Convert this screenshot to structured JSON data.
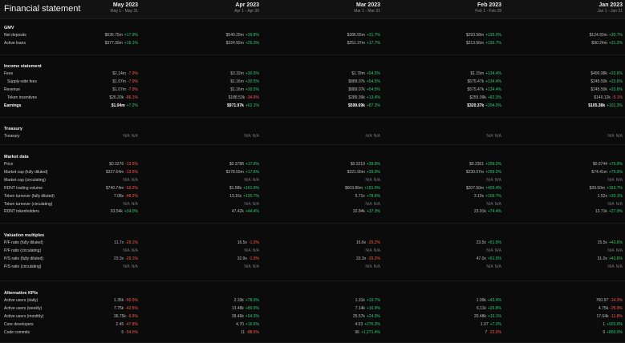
{
  "page_title": "Financial statement",
  "columns": [
    {
      "month": "May 2023",
      "range": "May 1 - May 31"
    },
    {
      "month": "Apr 2023",
      "range": "Apr 1 - Apr 30"
    },
    {
      "month": "Mar 2023",
      "range": "Mar 1 - Mar 31"
    },
    {
      "month": "Feb 2023",
      "range": "Feb 1 - Feb 28"
    },
    {
      "month": "Jan 2023",
      "range": "Jan 1 - Jan 31"
    }
  ],
  "sections": [
    {
      "title": "GMV",
      "rows": [
        {
          "label": "Net deposits",
          "cells": [
            [
              "$636.75m",
              "+17.9%"
            ],
            [
              "$540.29m",
              "+39.8%"
            ],
            [
              "$386.55m",
              "+31.7%"
            ],
            [
              "$293.58m",
              "+135.0%"
            ],
            [
              "$124.93m",
              "+30.7%"
            ]
          ]
        },
        {
          "label": "Active loans",
          "cells": [
            [
              "$377.39m",
              "+16.1%"
            ],
            [
              "$324.92m",
              "+29.3%"
            ],
            [
              "$251.37m",
              "+17.7%"
            ],
            [
              "$213.56m",
              "+136.7%"
            ],
            [
              "$90.24m",
              "+31.2%"
            ]
          ]
        }
      ]
    },
    {
      "title": "Income statement",
      "rows": [
        {
          "label": "Fees",
          "cells": [
            [
              "$2.14m",
              "-7.9%"
            ],
            [
              "$3.32m",
              "+30.5%"
            ],
            [
              "$1.78m",
              "+54.5%"
            ],
            [
              "$1.15m",
              "+134.4%"
            ],
            [
              "$490.98k",
              "+33.6%"
            ]
          ]
        },
        {
          "label": "Supply-side fees",
          "indent": true,
          "cells": [
            [
              "$1.07m",
              "-7.9%"
            ],
            [
              "$1.16m",
              "+30.5%"
            ],
            [
              "$889.07k",
              "+54.5%"
            ],
            [
              "$575.47k",
              "+134.4%"
            ],
            [
              "$245.50k",
              "+33.6%"
            ]
          ]
        },
        {
          "label": "Revenue",
          "cells": [
            [
              "$1.07m",
              "-7.9%"
            ],
            [
              "$1.16m",
              "+30.5%"
            ],
            [
              "$889.07k",
              "+54.5%"
            ],
            [
              "$575.47k",
              "+134.4%"
            ],
            [
              "$245.50k",
              "+33.6%"
            ]
          ]
        },
        {
          "label": "Token incentives",
          "indent": true,
          "cells": [
            [
              "$26.20k",
              "-86.1%"
            ],
            [
              "$188.53k",
              "-34.9%"
            ],
            [
              "$289.39k",
              "+13.4%"
            ],
            [
              "$255.09k",
              "+82.3%"
            ],
            [
              "$140.12k",
              "-5.1%"
            ]
          ]
        },
        {
          "label": "Earnings",
          "bold": true,
          "cells": [
            [
              "$1.04m",
              "+7.2%"
            ],
            [
              "$971.97k",
              "+62.1%"
            ],
            [
              "$599.69k",
              "+87.3%"
            ],
            [
              "$320.37k",
              "+204.0%"
            ],
            [
              "$105.38k",
              "+101.3%"
            ]
          ]
        }
      ]
    },
    {
      "title": "Treasury",
      "rows": [
        {
          "label": "Treasury",
          "cells": [
            [
              "N/A",
              "N/A"
            ],
            [
              "N/A",
              "N/A"
            ],
            [
              "N/A",
              "N/A"
            ],
            [
              "N/A",
              "N/A"
            ],
            [
              "N/A",
              "N/A"
            ]
          ]
        }
      ]
    },
    {
      "title": "Market data",
      "rows": [
        {
          "label": "Price",
          "cells": [
            [
              "$0.3276",
              "-13.5%"
            ],
            [
              "$0.3788",
              "+17.6%"
            ],
            [
              "$0.3219",
              "+39.9%"
            ],
            [
              "$0.2301",
              "+209.2%"
            ],
            [
              "$0.0744",
              "+75.9%"
            ]
          ]
        },
        {
          "label": "Market cap (fully diluted)",
          "cells": [
            [
              "$327.64m",
              "-13.5%"
            ],
            [
              "$378.59m",
              "+17.6%"
            ],
            [
              "$321.90m",
              "+39.9%"
            ],
            [
              "$230.07m",
              "+209.2%"
            ],
            [
              "$74.41m",
              "+75.9%"
            ]
          ]
        },
        {
          "label": "Market cap (circulating)",
          "cells": [
            [
              "N/A",
              "N/A"
            ],
            [
              "N/A",
              "N/A"
            ],
            [
              "N/A",
              "N/A"
            ],
            [
              "N/A",
              "N/A"
            ],
            [
              "N/A",
              "N/A"
            ]
          ]
        },
        {
          "label": "RDNT trading volume",
          "cells": [
            [
              "$740.74m",
              "-53.2%"
            ],
            [
              "$1.58b",
              "+161.9%"
            ],
            [
              "$603.86m",
              "+191.0%"
            ],
            [
              "$207.50m",
              "+425.4%"
            ],
            [
              "$39.50m",
              "+153.7%"
            ]
          ]
        },
        {
          "label": "Token turnover (fully diluted)",
          "cells": [
            [
              "7.08x",
              "-46.2%"
            ],
            [
              "13.16x",
              "+130.7%"
            ],
            [
              "5.71x",
              "+78.6%"
            ],
            [
              "3.19x",
              "+109.7%"
            ],
            [
              "1.52x",
              "+30.1%"
            ]
          ]
        },
        {
          "label": "Token turnover (circulating)",
          "cells": [
            [
              "N/A",
              "N/A"
            ],
            [
              "N/A",
              "N/A"
            ],
            [
              "N/A",
              "N/A"
            ],
            [
              "N/A",
              "N/A"
            ],
            [
              "N/A",
              "N/A"
            ]
          ]
        },
        {
          "label": "RDNT tokenholders",
          "cells": [
            [
              "63.54k",
              "+34.0%"
            ],
            [
              "47.42k",
              "+44.4%"
            ],
            [
              "32.84k",
              "+37.3%"
            ],
            [
              "23.91k",
              "+74.4%"
            ],
            [
              "13.71k",
              "+27.9%"
            ]
          ]
        }
      ]
    },
    {
      "title": "Valuation multiples",
      "rows": [
        {
          "label": "P/F ratio (fully diluted)",
          "cells": [
            [
              "11.7x",
              "-29.1%"
            ],
            [
              "16.5x",
              "-1.0%"
            ],
            [
              "16.6x",
              "-29.2%"
            ],
            [
              "23.5x",
              "+51.5%"
            ],
            [
              "15.5x",
              "+43.6%"
            ]
          ]
        },
        {
          "label": "P/F ratio (circulating)",
          "cells": [
            [
              "N/A",
              "N/A"
            ],
            [
              "N/A",
              "N/A"
            ],
            [
              "N/A",
              "N/A"
            ],
            [
              "N/A",
              "N/A"
            ],
            [
              "N/A",
              "N/A"
            ]
          ]
        },
        {
          "label": "P/S ratio (fully diluted)",
          "cells": [
            [
              "23.3x",
              "-29.1%"
            ],
            [
              "32.9x",
              "-1.0%"
            ],
            [
              "33.3x",
              "-29.2%"
            ],
            [
              "47.0x",
              "+51.5%"
            ],
            [
              "31.0x",
              "+43.6%"
            ]
          ]
        },
        {
          "label": "P/S ratio (circulating)",
          "cells": [
            [
              "N/A",
              "N/A"
            ],
            [
              "N/A",
              "N/A"
            ],
            [
              "N/A",
              "N/A"
            ],
            [
              "N/A",
              "N/A"
            ],
            [
              "N/A",
              "N/A"
            ]
          ]
        }
      ]
    },
    {
      "title": "Alternative KPIs",
      "rows": [
        {
          "label": "Active users (daily)",
          "cells": [
            [
              "1.35k",
              "-50.5%"
            ],
            [
              "2.33k",
              "+78.0%"
            ],
            [
              "1.31k",
              "+19.7%"
            ],
            [
              "1.09k",
              "+43.4%"
            ],
            [
              "760.97",
              "-14.3%"
            ]
          ]
        },
        {
          "label": "Active users (weekly)",
          "cells": [
            [
              "7.75k",
              "-42.5%"
            ],
            [
              "13.48k",
              "+89.9%"
            ],
            [
              "7.14k",
              "+16.9%"
            ],
            [
              "6.11k",
              "+26.8%"
            ],
            [
              "4.75k",
              "-25.0%"
            ]
          ]
        },
        {
          "label": "Active users (monthly)",
          "cells": [
            [
              "36.75k",
              "-6.9%"
            ],
            [
              "39.46k",
              "+54.3%"
            ],
            [
              "25.57k",
              "+24.9%"
            ],
            [
              "20.48k",
              "+16.1%"
            ],
            [
              "17.64k",
              "-11.8%"
            ]
          ]
        },
        {
          "label": "Core developers",
          "cells": [
            [
              "2.45",
              "-47.8%"
            ],
            [
              "4.70",
              "+16.6%"
            ],
            [
              "4.03",
              "+276.3%"
            ],
            [
              "1.07",
              "+7.2%"
            ],
            [
              "1",
              "+920.0%"
            ]
          ]
        },
        {
          "label": "Code commits",
          "cells": [
            [
              "5",
              "-54.5%"
            ],
            [
              "11",
              "-88.5%"
            ],
            [
              "96",
              "+1,271.4%"
            ],
            [
              "7",
              "-22.2%"
            ],
            [
              "9",
              "+800.0%"
            ]
          ]
        }
      ]
    }
  ]
}
